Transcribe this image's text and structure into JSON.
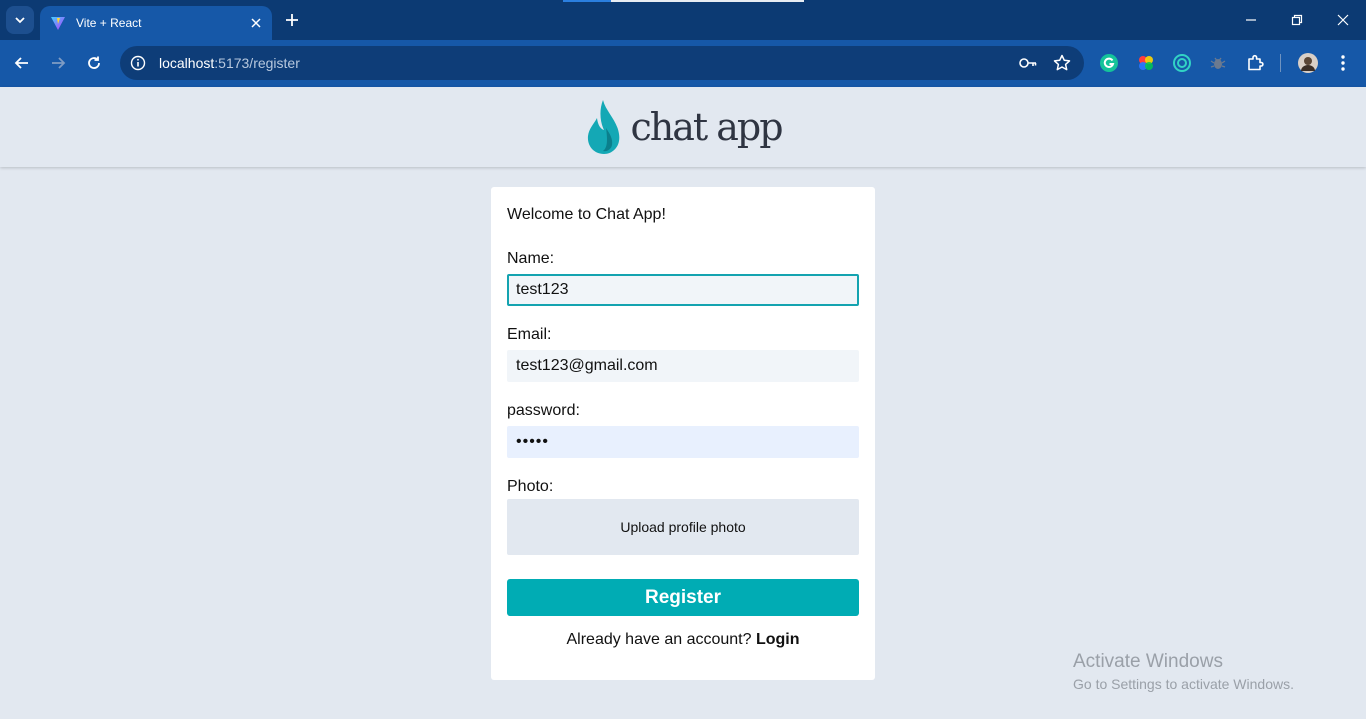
{
  "browser": {
    "tab_title": "Vite + React",
    "url_host": "localhost",
    "url_path": ":5173/register"
  },
  "header": {
    "logo_text": "chat app"
  },
  "form": {
    "welcome": "Welcome to Chat App!",
    "name_label": "Name:",
    "name_value": "test123",
    "email_label": "Email:",
    "email_value": "test123@gmail.com",
    "password_label": "password:",
    "password_value": "•••••",
    "photo_label": "Photo:",
    "upload_label": "Upload profile photo",
    "register_label": "Register",
    "login_prompt": "Already have an account? ",
    "login_link": "Login"
  },
  "os_watermark": {
    "line1": "Activate Windows",
    "line2": "Go to Settings to activate Windows."
  },
  "colors": {
    "accent": "#00acb4",
    "chrome_tabbar": "#0c3a73",
    "chrome_toolbar": "#1658a8",
    "page_bg": "#e2e8f0"
  }
}
